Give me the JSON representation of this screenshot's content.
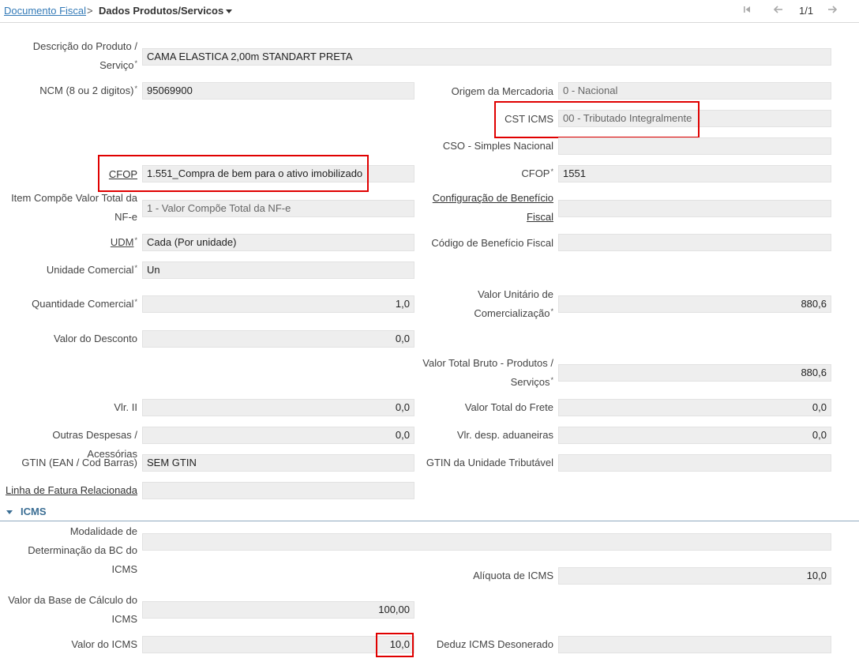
{
  "breadcrumb": {
    "parent": "Documento Fiscal",
    "separator": ">",
    "current": "Dados Produtos/Servicos"
  },
  "pager": {
    "first_icon": "first-page-icon",
    "prev_icon": "arrow-left-icon",
    "value": "1/1",
    "next_icon": "arrow-right-icon"
  },
  "form": {
    "descricao": {
      "label_l1": "Descrição do Produto /",
      "label_l2": "Serviço",
      "value": "CAMA ELASTICA 2,00m STANDART PRETA"
    },
    "ncm": {
      "label": "NCM (8 ou 2 digitos)",
      "value": "95069900"
    },
    "origem": {
      "label": "Origem da Mercadoria",
      "value": "0 - Nacional"
    },
    "cst_icms": {
      "label": "CST ICMS",
      "value": "00 - Tributado Integralmente"
    },
    "cso": {
      "label": "CSO - Simples Nacional",
      "value": ""
    },
    "cfop_link": {
      "label": "CFOP",
      "value": "1.551_Compra de bem para o ativo imobilizado"
    },
    "cfop": {
      "label": "CFOP",
      "value": "1551"
    },
    "item_compoe": {
      "label_l1": "Item Compõe Valor Total da",
      "label_l2": "NF-e",
      "value": "1 - Valor Compõe Total da NF-e"
    },
    "config_beneficio": {
      "label_l1": "Configuração de Benefício",
      "label_l2": "Fiscal",
      "value": ""
    },
    "udm": {
      "label": "UDM",
      "value": "Cada (Por unidade)"
    },
    "codigo_beneficio": {
      "label": "Código de Benefício Fiscal",
      "value": ""
    },
    "unidade_comercial": {
      "label": "Unidade Comercial",
      "value": "Un"
    },
    "quantidade_comercial": {
      "label": "Quantidade Comercial",
      "value": "1,0"
    },
    "valor_unitario": {
      "label_l1": "Valor Unitário de",
      "label_l2": "Comercialização",
      "value": "880,6"
    },
    "valor_desconto": {
      "label": "Valor do Desconto",
      "value": "0,0"
    },
    "valor_total_bruto": {
      "label_l1": "Valor Total Bruto - Produtos /",
      "label_l2": "Serviços",
      "value": "880,6"
    },
    "vlr_ii": {
      "label": "Vlr. II",
      "value": "0,0"
    },
    "valor_frete": {
      "label": "Valor Total do Frete",
      "value": "0,0"
    },
    "outras_despesas": {
      "label": "Outras Despesas / Acessórias",
      "value": "0,0"
    },
    "desp_aduaneiras": {
      "label": "Vlr. desp. aduaneiras",
      "value": "0,0"
    },
    "gtin": {
      "label": "GTIN (EAN / Cod Barras)",
      "value": "SEM GTIN"
    },
    "gtin_tributavel": {
      "label": "GTIN da Unidade Tributável",
      "value": ""
    },
    "linha_fatura": {
      "label": "Linha de Fatura Relacionada",
      "value": ""
    }
  },
  "icms": {
    "title": "ICMS",
    "modalidade": {
      "label_l1": "Modalidade de",
      "label_l2": "Determinação da BC do ICMS",
      "value": ""
    },
    "aliquota": {
      "label": "Alíquota de ICMS",
      "value": "10,0"
    },
    "base_calculo": {
      "label_l1": "Valor da Base de Cálculo do",
      "label_l2": "ICMS",
      "value": "100,00"
    },
    "valor_icms": {
      "label": "Valor do ICMS",
      "value": "10,0"
    },
    "deduz_desonerado": {
      "label": "Deduz ICMS Desonerado",
      "value": ""
    }
  },
  "required_mark": "*"
}
